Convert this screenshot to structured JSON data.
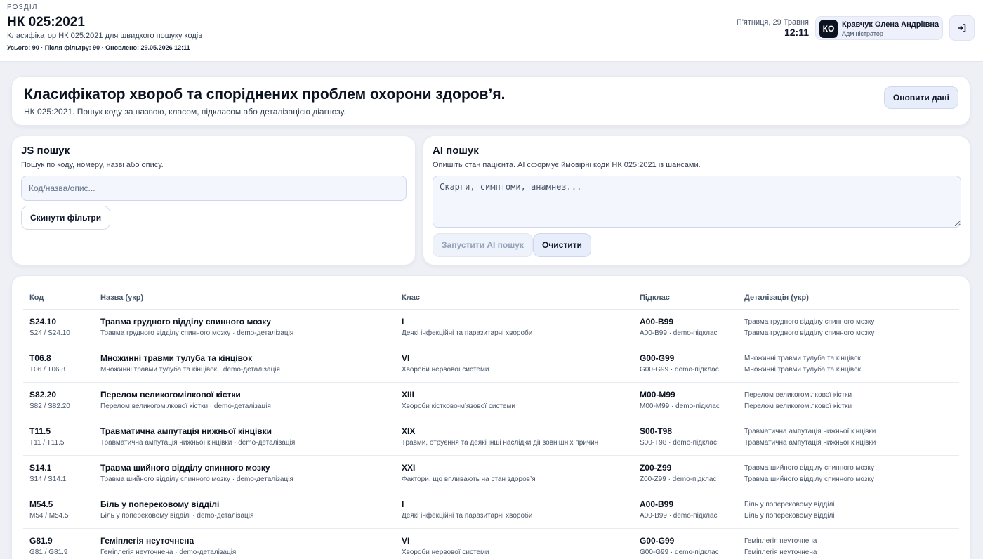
{
  "header": {
    "section_label": "РОЗДІЛ",
    "title": "НК 025:2021",
    "subtitle": "Класифікатор НК 025:2021 для швидкого пошуку кодів",
    "stats": "Усього: 90 · Після фільтру: 90 · Оновлено: 29.05.2026 12:11",
    "date": "П'ятниця, 29 Травня",
    "time": "12:11",
    "user": {
      "initials": "КО",
      "name": "Кравчук Олена Андріївна",
      "role": "Адміністратор"
    },
    "logout_icon": "logout-icon"
  },
  "hero": {
    "title": "Класифікатор хвороб та споріднених проблем охорони здоров’я.",
    "subtitle": "НК 025:2021. Пошук коду за назвою, класом, підкласом або деталізацією діагнозу.",
    "refresh_label": "Оновити дані"
  },
  "js_search": {
    "title": "JS пошук",
    "description": "Пошук по коду, номеру, назві або опису.",
    "placeholder": "Код/назва/опис...",
    "reset_label": "Скинути фільтри"
  },
  "ai_search": {
    "title": "AI пошук",
    "description": "Опишіть стан пацієнта. AI сформує ймовірні коди НК 025:2021 із шансами.",
    "placeholder": "Скарги, симптоми, анамнез...",
    "run_label": "Запустити AI пошук",
    "clear_label": "Очистити"
  },
  "table": {
    "columns": {
      "code": "Код",
      "name": "Назва (укр)",
      "class": "Клас",
      "subclass": "Підклас",
      "detail": "Деталізація (укр)"
    },
    "rows": [
      {
        "code": "S24.10",
        "code_sub": "S24 / S24.10",
        "name": "Травма грудного відділу спинного мозку",
        "name_sub": "Травма грудного відділу спинного мозку · demo-деталізація",
        "class": "I",
        "class_sub": "Деякі інфекційні та паразитарні хвороби",
        "subclass": "A00-B99",
        "subclass_sub": "A00-B99 · demo-підклас",
        "detail_1": "Травма грудного відділу спинного мозку",
        "detail_2": "Травма грудного відділу спинного мозку"
      },
      {
        "code": "T06.8",
        "code_sub": "T06 / T06.8",
        "name": "Множинні травми тулуба та кінцівок",
        "name_sub": "Множинні травми тулуба та кінцівок · demo-деталізація",
        "class": "VI",
        "class_sub": "Хвороби нервової системи",
        "subclass": "G00-G99",
        "subclass_sub": "G00-G99 · demo-підклас",
        "detail_1": "Множинні травми тулуба та кінцівок",
        "detail_2": "Множинні травми тулуба та кінцівок"
      },
      {
        "code": "S82.20",
        "code_sub": "S82 / S82.20",
        "name": "Перелом великогомілкової кістки",
        "name_sub": "Перелом великогомілкової кістки · demo-деталізація",
        "class": "XIII",
        "class_sub": "Хвороби кістково-м’язової системи",
        "subclass": "M00-M99",
        "subclass_sub": "M00-M99 · demo-підклас",
        "detail_1": "Перелом великогомілкової кістки",
        "detail_2": "Перелом великогомілкової кістки"
      },
      {
        "code": "T11.5",
        "code_sub": "T11 / T11.5",
        "name": "Травматична ампутація нижньої кінцівки",
        "name_sub": "Травматична ампутація нижньої кінцівки · demo-деталізація",
        "class": "XIX",
        "class_sub": "Травми, отруєння та деякі інші наслідки дії зовнішніх причин",
        "subclass": "S00-T98",
        "subclass_sub": "S00-T98 · demo-підклас",
        "detail_1": "Травматична ампутація нижньої кінцівки",
        "detail_2": "Травматична ампутація нижньої кінцівки"
      },
      {
        "code": "S14.1",
        "code_sub": "S14 / S14.1",
        "name": "Травма шийного відділу спинного мозку",
        "name_sub": "Травма шийного відділу спинного мозку · demo-деталізація",
        "class": "XXI",
        "class_sub": "Фактори, що впливають на стан здоров’я",
        "subclass": "Z00-Z99",
        "subclass_sub": "Z00-Z99 · demo-підклас",
        "detail_1": "Травма шийного відділу спинного мозку",
        "detail_2": "Травма шийного відділу спинного мозку"
      },
      {
        "code": "M54.5",
        "code_sub": "M54 / M54.5",
        "name": "Біль у поперековому відділі",
        "name_sub": "Біль у поперековому відділі · demo-деталізація",
        "class": "I",
        "class_sub": "Деякі інфекційні та паразитарні хвороби",
        "subclass": "A00-B99",
        "subclass_sub": "A00-B99 · demo-підклас",
        "detail_1": "Біль у поперековому відділі",
        "detail_2": "Біль у поперековому відділі"
      },
      {
        "code": "G81.9",
        "code_sub": "G81 / G81.9",
        "name": "Геміплегія неуточнена",
        "name_sub": "Геміплегія неуточнена · demo-деталізація",
        "class": "VI",
        "class_sub": "Хвороби нервової системи",
        "subclass": "G00-G99",
        "subclass_sub": "G00-G99 · demo-підклас",
        "detail_1": "Геміплегія неуточнена",
        "detail_2": "Геміплегія неуточнена"
      }
    ]
  }
}
